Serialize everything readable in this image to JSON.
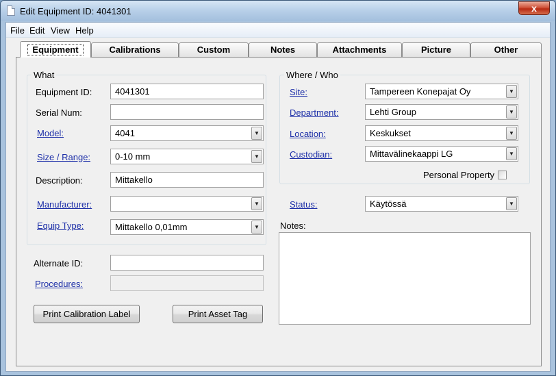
{
  "window": {
    "title": "Edit Equipment ID: 4041301",
    "close_glyph": "x"
  },
  "menu": [
    "File",
    "Edit",
    "View",
    "Help"
  ],
  "tabs": [
    "Equipment",
    "Calibrations",
    "Custom",
    "Notes",
    "Attachments",
    "Picture",
    "Other"
  ],
  "what": {
    "legend": "What",
    "equipment_id": {
      "label": "Equipment ID:",
      "value": "4041301"
    },
    "serial_num": {
      "label": "Serial Num:",
      "value": ""
    },
    "model": {
      "label": "Model:",
      "value": "4041"
    },
    "size_range": {
      "label": "Size / Range:",
      "value": "0-10 mm"
    },
    "description": {
      "label": "Description:",
      "value": "Mittakello"
    },
    "manufacturer": {
      "label": "Manufacturer:",
      "value": ""
    },
    "equip_type": {
      "label": "Equip Type:",
      "value": "Mittakello 0,01mm"
    }
  },
  "alternate_id": {
    "label": "Alternate ID:",
    "value": ""
  },
  "procedures": {
    "label": "Procedures:",
    "value": ""
  },
  "where": {
    "legend": "Where / Who",
    "site": {
      "label": "Site:",
      "value": "Tampereen Konepajat Oy"
    },
    "department": {
      "label": "Department:",
      "value": "Lehti Group"
    },
    "location": {
      "label": "Location:",
      "value": "Keskukset"
    },
    "custodian": {
      "label": "Custodian:",
      "value": "Mittavälinekaappi LG"
    },
    "personal_property": {
      "label": "Personal Property",
      "checked": false
    }
  },
  "status": {
    "label": "Status:",
    "value": "Käytössä"
  },
  "notes": {
    "label": "Notes:",
    "value": ""
  },
  "buttons": {
    "print_calibration": "Print Calibration Label",
    "print_asset": "Print Asset Tag"
  },
  "colors": {
    "link": "#1d2fa8",
    "close_button": "#c8462b"
  }
}
